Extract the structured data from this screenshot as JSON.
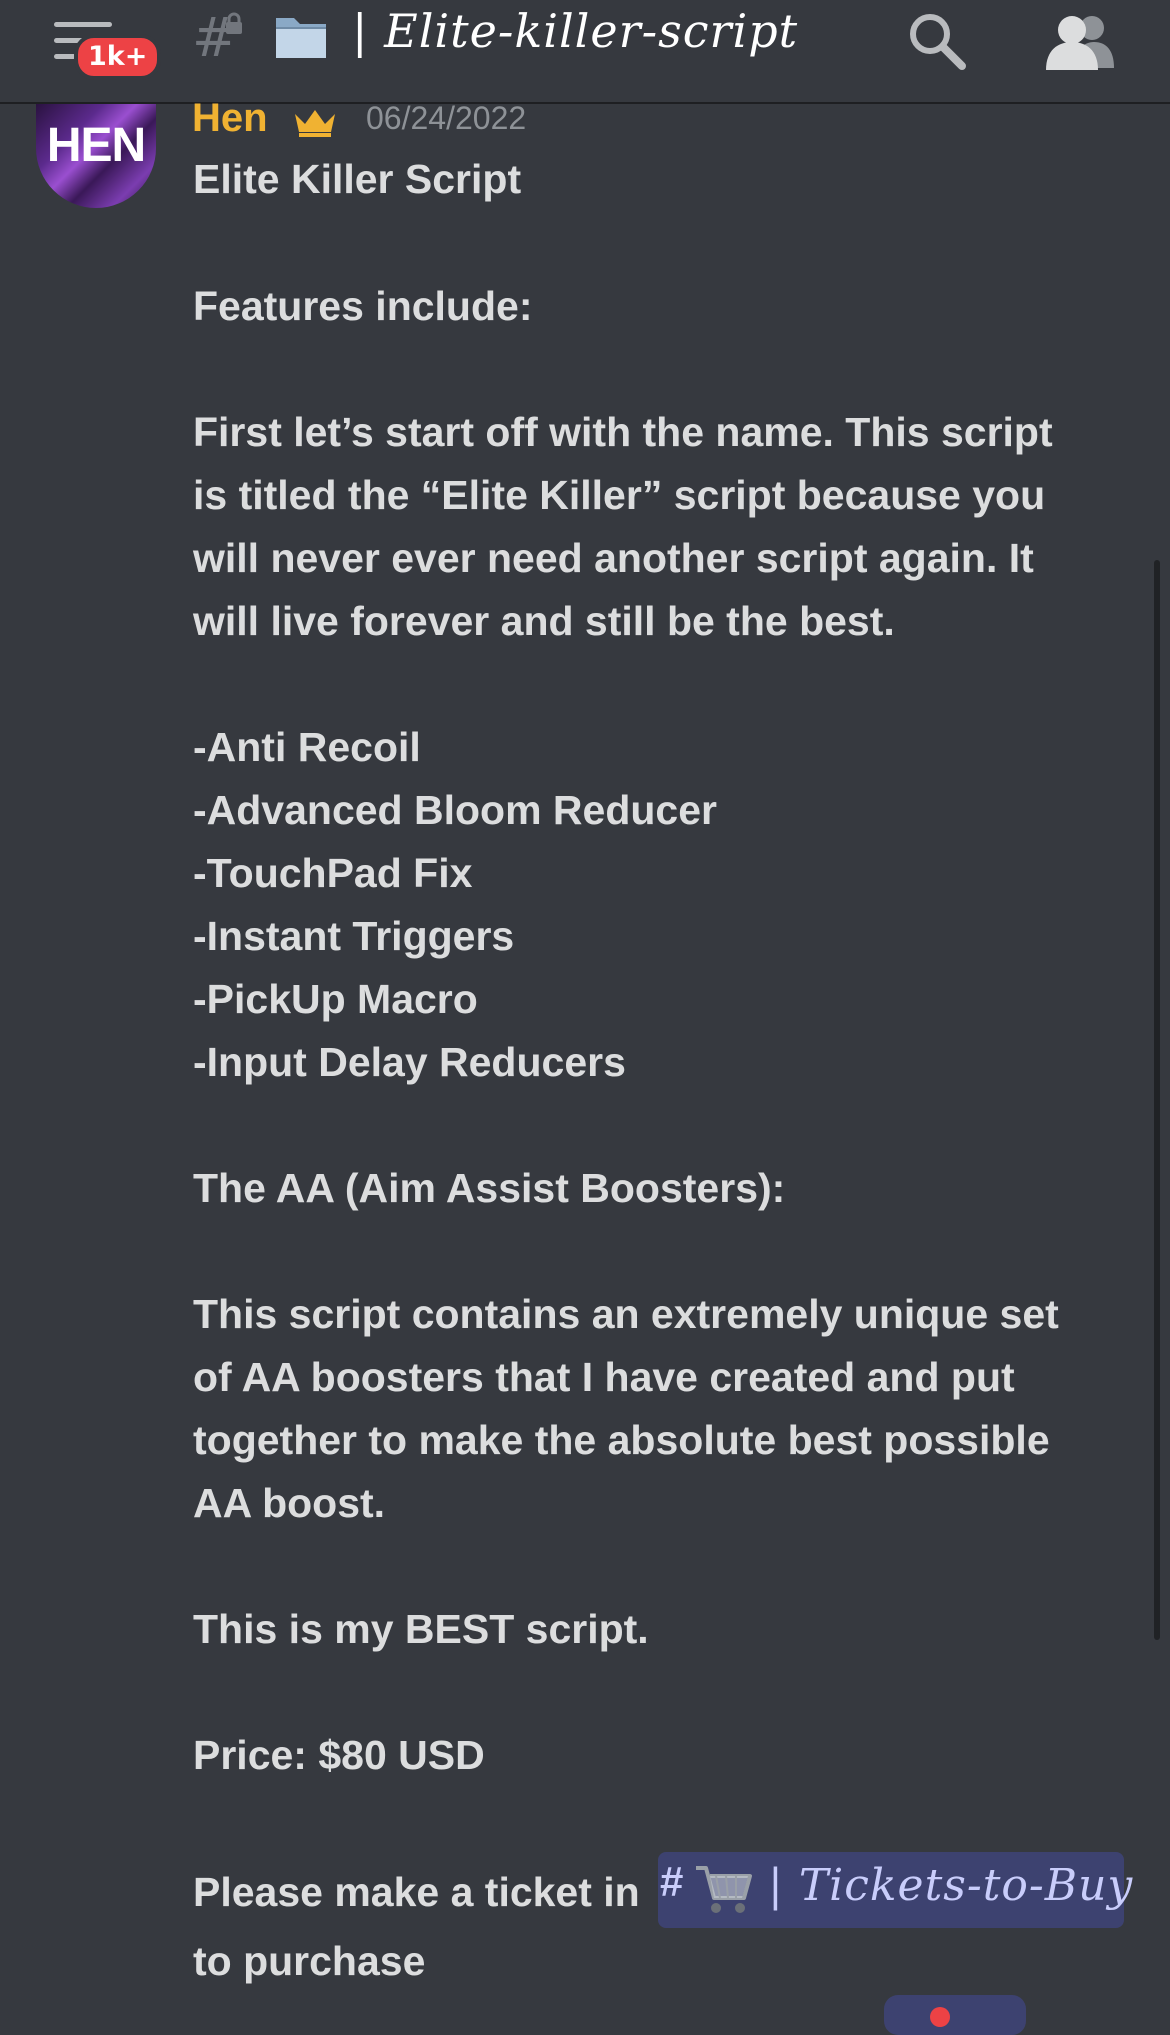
{
  "header": {
    "notification_badge": "1k+",
    "channel_prefix": "#",
    "channel_separator": "|",
    "channel_name": "Elite-killer-script"
  },
  "message": {
    "author": "Hen",
    "avatar_text": "HEN",
    "timestamp": "06/24/2022",
    "author_color": "#f0b232",
    "lines": [
      " Elite Killer Script",
      "Features include:",
      "First let’s start off with the name. This script",
      "is titled the “Elite Killer” script because you",
      "will never ever need another script again. It",
      "will live forever and still be the best.",
      "-Anti Recoil",
      "-Advanced Bloom Reducer",
      "-TouchPad Fix",
      "-Instant Triggers",
      "-PickUp Macro",
      "-Input Delay Reducers",
      "The AA (Aim Assist Boosters):",
      "This script contains an extremely unique set",
      "of AA boosters that I have created and put",
      "together to make the absolute best possible",
      "AA boost.",
      "This is my BEST script.",
      "Price: $80 USD",
      "Please make a ticket in",
      "to purchase"
    ],
    "mention": {
      "hash": "#",
      "icon": "shopping-cart-icon",
      "separator": "|",
      "name": "Tickets-to-Buy"
    }
  },
  "colors": {
    "background": "#36393f",
    "text": "#dcddde",
    "mention_bg": "#3d4270",
    "badge": "#ed4245"
  }
}
